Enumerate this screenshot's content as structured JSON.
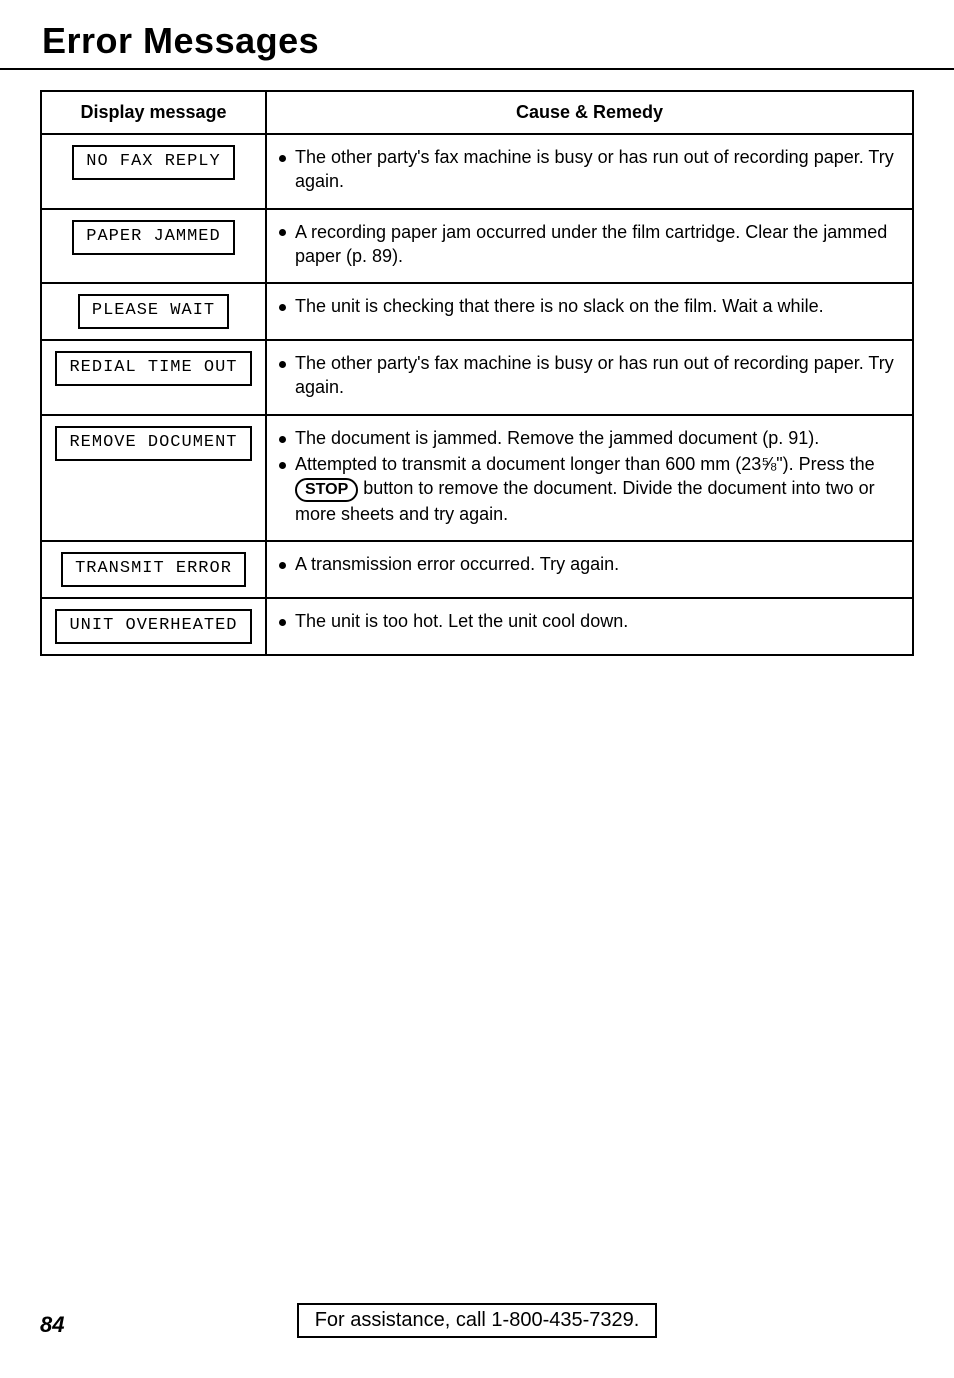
{
  "title": "Error Messages",
  "headers": {
    "display": "Display message",
    "remedy": "Cause & Remedy"
  },
  "rows": [
    {
      "msg": "NO FAX REPLY",
      "items": [
        {
          "text": "The other party's fax machine is busy or has run out of recording paper. Try again."
        }
      ]
    },
    {
      "msg": "PAPER JAMMED",
      "items": [
        {
          "text": "A recording paper jam occurred under the film cartridge. Clear the jammed paper (p. 89)."
        }
      ]
    },
    {
      "msg": "PLEASE WAIT",
      "items": [
        {
          "text": "The unit is checking that there is no slack on the film. Wait a while."
        }
      ]
    },
    {
      "msg": "REDIAL TIME OUT",
      "items": [
        {
          "text": "The other party's fax machine is busy or has run out of recording paper. Try again."
        }
      ]
    },
    {
      "msg": "REMOVE DOCUMENT",
      "items": [
        {
          "text": "The document is jammed. Remove the jammed document (p. 91)."
        },
        {
          "pre": "Attempted to transmit a document longer than 600 mm (23⅝\"). Press the ",
          "pill": "STOP",
          "post": " button to remove the document. Divide the document into two or more sheets and try again."
        }
      ]
    },
    {
      "msg": "TRANSMIT ERROR",
      "items": [
        {
          "text": "A transmission error occurred. Try again."
        }
      ]
    },
    {
      "msg": "UNIT OVERHEATED",
      "items": [
        {
          "text": "The unit is too hot. Let the unit cool down."
        }
      ]
    }
  ],
  "footer": {
    "page": "84",
    "assist": "For assistance, call 1-800-435-7329."
  }
}
